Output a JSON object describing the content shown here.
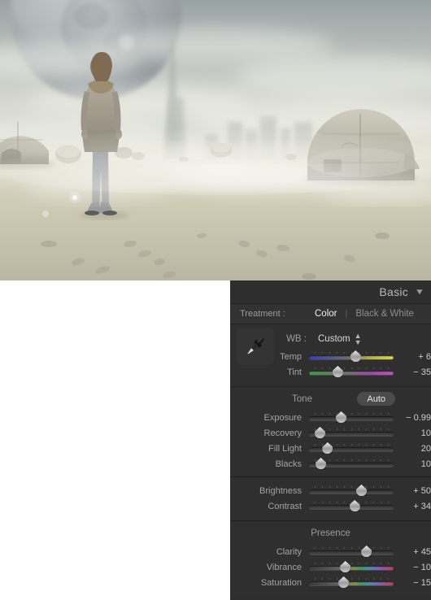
{
  "photo": {
    "alt_description": "Post-apocalyptic desert scene with a person standing in sand, two large planets in a hazy sky, a distant tower and ruined domes"
  },
  "panel": {
    "title": "Basic",
    "collapse_icon": "chevron-down-icon",
    "treatment": {
      "label": "Treatment :",
      "options": [
        {
          "label": "Color",
          "selected": true
        },
        {
          "label": "Black & White",
          "selected": false
        }
      ]
    },
    "white_balance": {
      "eyedropper_icon": "eyedropper-icon",
      "label": "WB :",
      "value": "Custom",
      "stepper_icon": "up-down-stepper-icon",
      "sliders": [
        {
          "name": "Temp",
          "value": "+ 6",
          "pos_pct": 55,
          "track": "temp"
        },
        {
          "name": "Tint",
          "value": "− 35",
          "pos_pct": 34,
          "track": "tint"
        }
      ]
    },
    "tone": {
      "header": "Tone",
      "auto_label": "Auto",
      "sliders": [
        {
          "name": "Exposure",
          "value": "− 0.99",
          "pos_pct": 38,
          "track": "plain"
        },
        {
          "name": "Recovery",
          "value": "10",
          "pos_pct": 13,
          "track": "plain"
        },
        {
          "name": "Fill Light",
          "value": "20",
          "pos_pct": 22,
          "track": "plain"
        },
        {
          "name": "Blacks",
          "value": "10",
          "pos_pct": 14,
          "track": "plain"
        }
      ]
    },
    "light": {
      "sliders": [
        {
          "name": "Brightness",
          "value": "+ 50",
          "pos_pct": 62,
          "track": "plain"
        },
        {
          "name": "Contrast",
          "value": "+ 34",
          "pos_pct": 54,
          "track": "plain"
        }
      ]
    },
    "presence": {
      "header": "Presence",
      "sliders": [
        {
          "name": "Clarity",
          "value": "+ 45",
          "pos_pct": 68,
          "track": "plain"
        },
        {
          "name": "Vibrance",
          "value": "− 10",
          "pos_pct": 43,
          "track": "sat"
        },
        {
          "name": "Saturation",
          "value": "− 15",
          "pos_pct": 41,
          "track": "sat"
        }
      ]
    }
  },
  "colors": {
    "panel_bg": "#2e2e2e",
    "section_bg": "#323232",
    "label": "#9c9c9c",
    "value": "#cfcfcf",
    "selected": "#f0f0f0",
    "canvas": "#ffffff"
  }
}
